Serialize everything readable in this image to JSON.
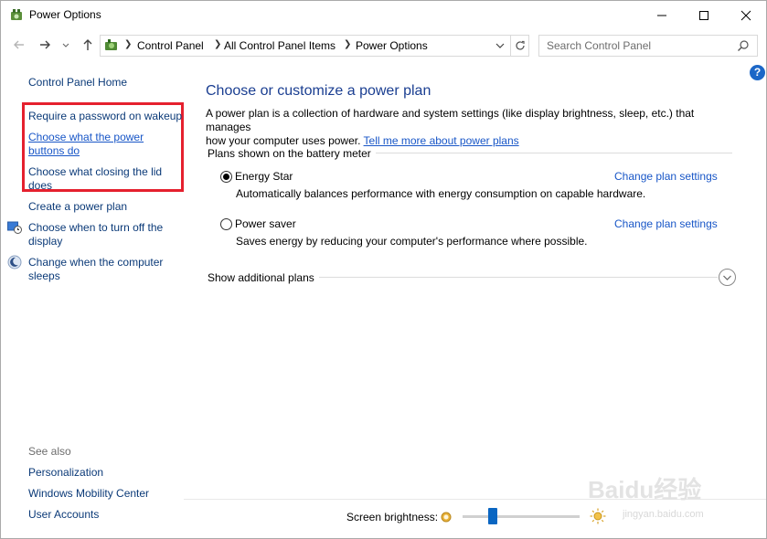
{
  "window": {
    "title": "Power Options"
  },
  "navigation": {
    "breadcrumbs": [
      "Control Panel",
      "All Control Panel Items",
      "Power Options"
    ],
    "search_placeholder": "Search Control Panel"
  },
  "sidebar": {
    "home_label": "Control Panel Home",
    "links": [
      "Require a password on wakeup",
      "Choose what the power",
      "buttons do",
      "Choose what closing the lid",
      "does",
      "Create a power plan",
      "Choose when to turn off the",
      "display",
      "Change when the computer",
      "sleeps"
    ],
    "see_also_title": "See also",
    "see_also": [
      "Personalization",
      "Windows Mobility Center",
      "User Accounts"
    ]
  },
  "main": {
    "heading": "Choose or customize a power plan",
    "description_line1": "A power plan is a collection of hardware and system settings (like display brightness, sleep, etc.) that manages",
    "description_line2": "how your computer uses power.",
    "learn_more_link": "Tell me more about power plans",
    "plans_section_title": "Plans shown on the battery meter",
    "plans": [
      {
        "name": "Energy Star",
        "description": "Automatically balances performance with energy consumption on capable hardware.",
        "link": "Change plan settings",
        "selected": true
      },
      {
        "name": "Power saver",
        "description": "Saves energy by reducing your computer's performance where possible.",
        "link": "Change plan settings",
        "selected": false
      }
    ],
    "additional_plans_label": "Show additional plans"
  },
  "footer": {
    "brightness_label": "Screen brightness:",
    "brightness_level": 0.24
  },
  "icons": {
    "help": "?"
  },
  "watermark": {
    "brand": "Baidu经验",
    "url": "jingyan.baidu.com"
  },
  "colors": {
    "heading": "#1a3e91",
    "link": "#1856c7",
    "highlight_box": "#e5202e",
    "slider_thumb": "#0a66c2"
  }
}
